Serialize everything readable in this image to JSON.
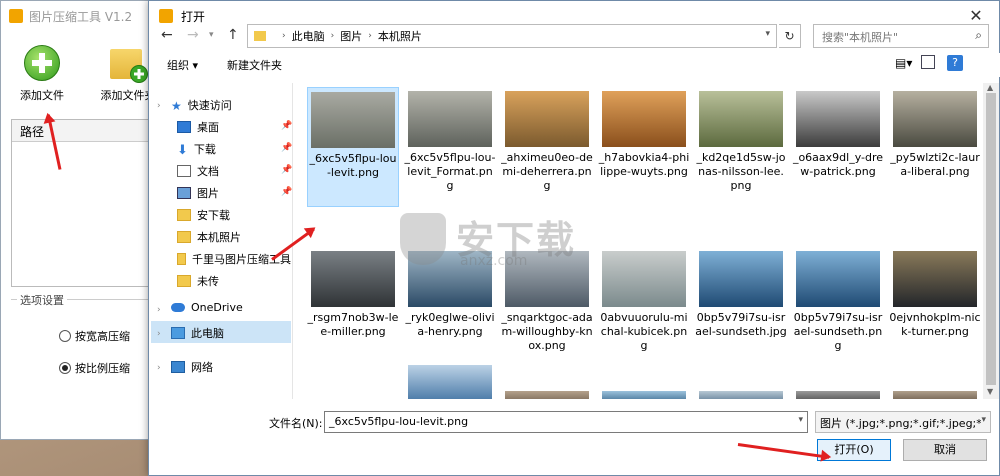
{
  "app": {
    "title": "图片压缩工具 V1.2",
    "add_file": "添加文件",
    "add_folder": "添加文件夹",
    "path_header": "路径",
    "options_title": "选项设置",
    "radio_width": "按宽高压缩",
    "radio_ratio": "按比例压缩"
  },
  "dialog": {
    "title": "打开",
    "close": "✕",
    "breadcrumb": [
      "此电脑",
      "图片",
      "本机照片"
    ],
    "search_placeholder": "搜索\"本机照片\"",
    "organize": "组织 ▾",
    "new_folder": "新建文件夹",
    "nav": {
      "quick_access": "快速访问",
      "desktop": "桌面",
      "downloads": "下载",
      "documents": "文档",
      "pictures": "图片",
      "anxz": "安下载",
      "local_photos": "本机照片",
      "qlm": "千里马图片压缩工具",
      "weichuan": "未传",
      "onedrive": "OneDrive",
      "this_pc": "此电脑",
      "network": "网络"
    },
    "files": [
      {
        "name": "_6xc5v5flpu-lou-levit.png",
        "c1": "#6a6f66",
        "c2": "#a9aaa2"
      },
      {
        "name": "_6xc5v5flpu-lou-levit_Format.png",
        "c1": "#5e625c",
        "c2": "#b3b3aa"
      },
      {
        "name": "_ahximeu0eo-demi-deherrera.png",
        "c1": "#7b5a2e",
        "c2": "#d9a25c"
      },
      {
        "name": "_h7abovkia4-philippe-wuyts.png",
        "c1": "#8a4f1c",
        "c2": "#e0a15a"
      },
      {
        "name": "_kd2qe1d5sw-jonas-nilsson-lee.png",
        "c1": "#5c6a3e",
        "c2": "#b9c09a"
      },
      {
        "name": "_o6aax9dl_y-drew-patrick.png",
        "c1": "#3c3c3c",
        "c2": "#c9c9c9"
      },
      {
        "name": "_py5wlzti2c-laura-liberal.png",
        "c1": "#4a4a40",
        "c2": "#b6b0a0"
      },
      {
        "name": "_rsgm7nob3w-lee-miller.png",
        "c1": "#2f3336",
        "c2": "#7a8085"
      },
      {
        "name": "_ryk0eglwe-olivia-henry.png",
        "c1": "#2b4a66",
        "c2": "#9fb6c6"
      },
      {
        "name": "_snqarktgoc-adam-willoughby-knox.png",
        "c1": "#4e5a66",
        "c2": "#b0b8bf"
      },
      {
        "name": "0abvuuorulu-michal-kubicek.png",
        "c1": "#7b8a8c",
        "c2": "#c9cdcc"
      },
      {
        "name": "0bp5v79i7su-israel-sundseth.jpg",
        "c1": "#1f4a73",
        "c2": "#7fb0d6"
      },
      {
        "name": "0bp5v79i7su-israel-sundseth.png",
        "c1": "#1f4a73",
        "c2": "#7fb0d6"
      },
      {
        "name": "0ejvnhokplm-nick-turner.png",
        "c1": "#23262a",
        "c2": "#8a7a5a"
      }
    ],
    "filename_label": "文件名(N):",
    "filename_value": "_6xc5v5flpu-lou-levit.png",
    "filetype_value": "图片 (*.jpg;*.png;*.gif;*.jpeg;*",
    "open": "打开(O)",
    "cancel": "取消"
  },
  "watermark": {
    "text": "安下载",
    "sub": "anxz.com"
  }
}
